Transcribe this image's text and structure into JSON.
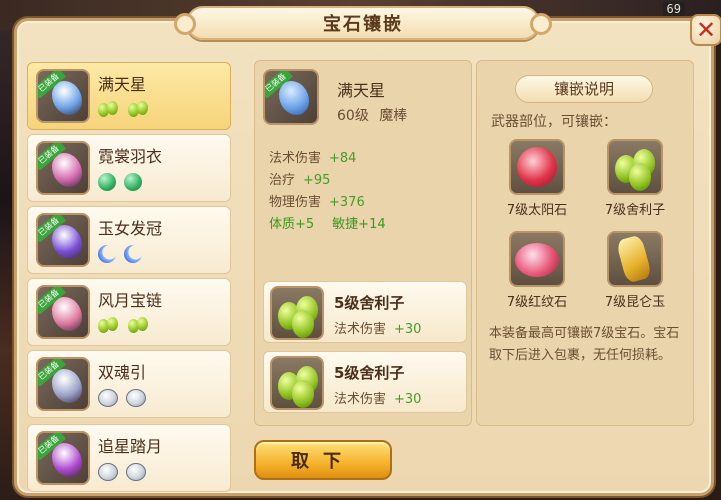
{
  "title": "宝石镶嵌",
  "top_number": "69",
  "close_label": "✕",
  "equipment": [
    {
      "name": "满天星",
      "tag": "已装备",
      "gem": "green-pair",
      "art": "#6ea4e8",
      "selected": true
    },
    {
      "name": "霓裳羽衣",
      "tag": "已装备",
      "gem": "jade",
      "art": "#d56bb0",
      "selected": false
    },
    {
      "name": "玉女发冠",
      "tag": "已装备",
      "gem": "moon",
      "art": "#7b4fd6",
      "selected": false
    },
    {
      "name": "风月宝链",
      "tag": "已装备",
      "gem": "green-pair",
      "art": "#e07aa0",
      "selected": false
    },
    {
      "name": "双魂引",
      "tag": "已装备",
      "gem": "diamond",
      "art": "#9aa2c8",
      "selected": false
    },
    {
      "name": "追星踏月",
      "tag": "已装备",
      "gem": "diamond",
      "art": "#b04ad0",
      "selected": false
    }
  ],
  "detail": {
    "name": "满天星",
    "level": "60级",
    "type": "魔棒",
    "stats": [
      {
        "label": "法术伤害",
        "value": "+84"
      },
      {
        "label": "治疗",
        "value": "+95"
      },
      {
        "label": "物理伤害",
        "value": "+376"
      }
    ],
    "attr1": "体质+5",
    "attr2": "敏捷+14",
    "slots": [
      {
        "name": "5级舍利子",
        "stat": "法术伤害",
        "value": "+30"
      },
      {
        "name": "5级舍利子",
        "stat": "法术伤害",
        "value": "+30"
      }
    ],
    "remove_button": "取下"
  },
  "info": {
    "title": "镶嵌说明",
    "subtitle": "武器部位，可镶嵌：",
    "gems": [
      {
        "name": "7级太阳石",
        "kind": "sun"
      },
      {
        "name": "7级舍利子",
        "kind": "green-pair"
      },
      {
        "name": "7级红纹石",
        "kind": "red"
      },
      {
        "name": "7级昆仑玉",
        "kind": "kunlun"
      }
    ],
    "note": "本装备最高可镶嵌7级宝石。宝石取下后进入包裹，无任何损耗。"
  },
  "colors": {
    "accent": "#f5b22c",
    "frame": "#c9a06a",
    "value_green": "#4a9a2a"
  }
}
